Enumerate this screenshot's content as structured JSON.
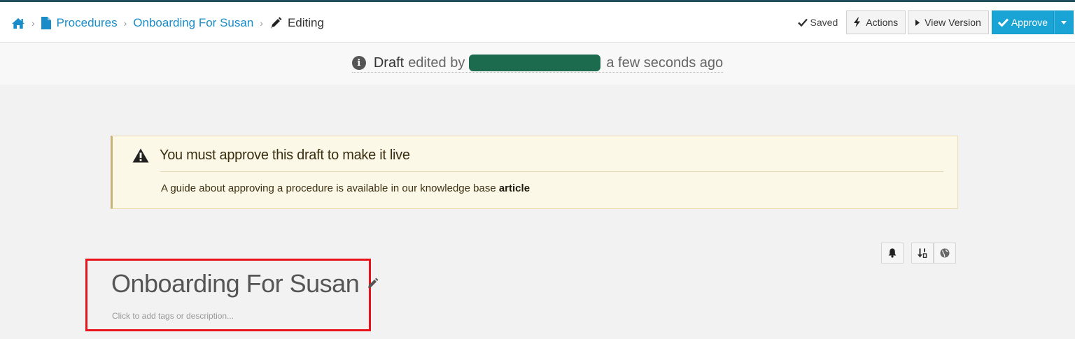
{
  "breadcrumb": {
    "home_icon": "home-icon",
    "procedures_label": "Procedures",
    "procedure_label": "Onboarding For Susan",
    "editing_label": "Editing",
    "separator": "›"
  },
  "toolbar": {
    "saved_label": "Saved",
    "actions_label": "Actions",
    "view_version_label": "View Version",
    "approve_label": "Approve"
  },
  "draft_status": {
    "status_word": "Draft",
    "edited_by_text": "edited by",
    "time_text": "a few seconds ago"
  },
  "alert": {
    "title": "You must approve this draft to make it live",
    "body_text": "A guide about approving a procedure is available in our knowledge base",
    "link_label": "article"
  },
  "procedure": {
    "title": "Onboarding For Susan",
    "description_placeholder": "Click to add tags or description..."
  },
  "colors": {
    "accent": "#1aa4d6",
    "link": "#1a8cc8",
    "alert_bg": "#fcf8e8",
    "highlight": "#e8141b"
  }
}
